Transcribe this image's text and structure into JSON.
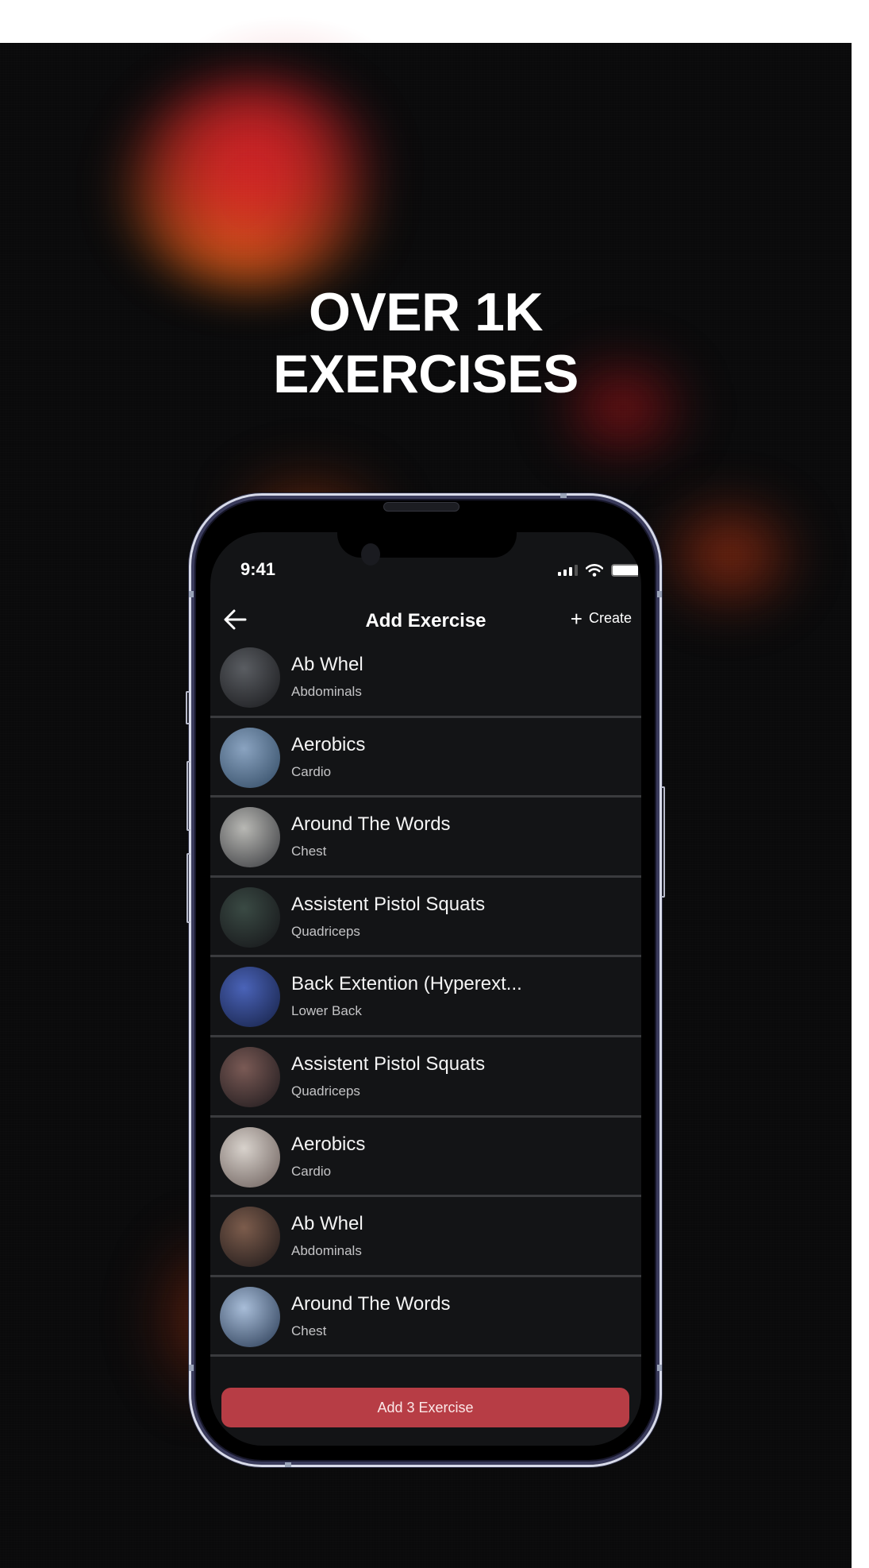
{
  "headline": {
    "line1": "OVER 1K",
    "line2": "EXERCISES"
  },
  "status_bar": {
    "time": "9:41",
    "icons": [
      "cellular-signal-icon",
      "wifi-icon",
      "battery-icon"
    ]
  },
  "nav": {
    "back_icon": "arrow-left-icon",
    "title": "Add Exercise",
    "create_icon": "plus-icon",
    "create_label": "Create"
  },
  "exercises": [
    {
      "name": "Ab Whel",
      "muscle": "Abdominals",
      "thumb_colors": [
        "#5a5d62",
        "#222326"
      ]
    },
    {
      "name": "Aerobics",
      "muscle": "Cardio",
      "thumb_colors": [
        "#8aa3c0",
        "#3d5670"
      ]
    },
    {
      "name": "Around The Words",
      "muscle": "Chest",
      "thumb_colors": [
        "#b8b8b4",
        "#4a4b4e"
      ]
    },
    {
      "name": "Assistent Pistol Squats",
      "muscle": "Quadriceps",
      "thumb_colors": [
        "#3a4a44",
        "#1a1c1e"
      ]
    },
    {
      "name": "Back Extention (Hyperext...",
      "muscle": "Lower Back",
      "thumb_colors": [
        "#4a63b8",
        "#1d2a55"
      ]
    },
    {
      "name": "Assistent Pistol Squats",
      "muscle": "Quadriceps",
      "thumb_colors": [
        "#7a5a55",
        "#2a2224"
      ]
    },
    {
      "name": "Aerobics",
      "muscle": "Cardio",
      "thumb_colors": [
        "#d8d2cc",
        "#7a6e6a"
      ]
    },
    {
      "name": "Ab Whel",
      "muscle": "Abdominals",
      "thumb_colors": [
        "#7c5c4c",
        "#2b2220"
      ]
    },
    {
      "name": "Around The Words",
      "muscle": "Chest",
      "thumb_colors": [
        "#a8bdd8",
        "#3a4c66"
      ]
    }
  ],
  "footer": {
    "add_button_label": "Add 3 Exercise"
  },
  "colors": {
    "accent": "#b73d45",
    "screen_bg": "#131416",
    "separator": "#3a3b3e"
  }
}
